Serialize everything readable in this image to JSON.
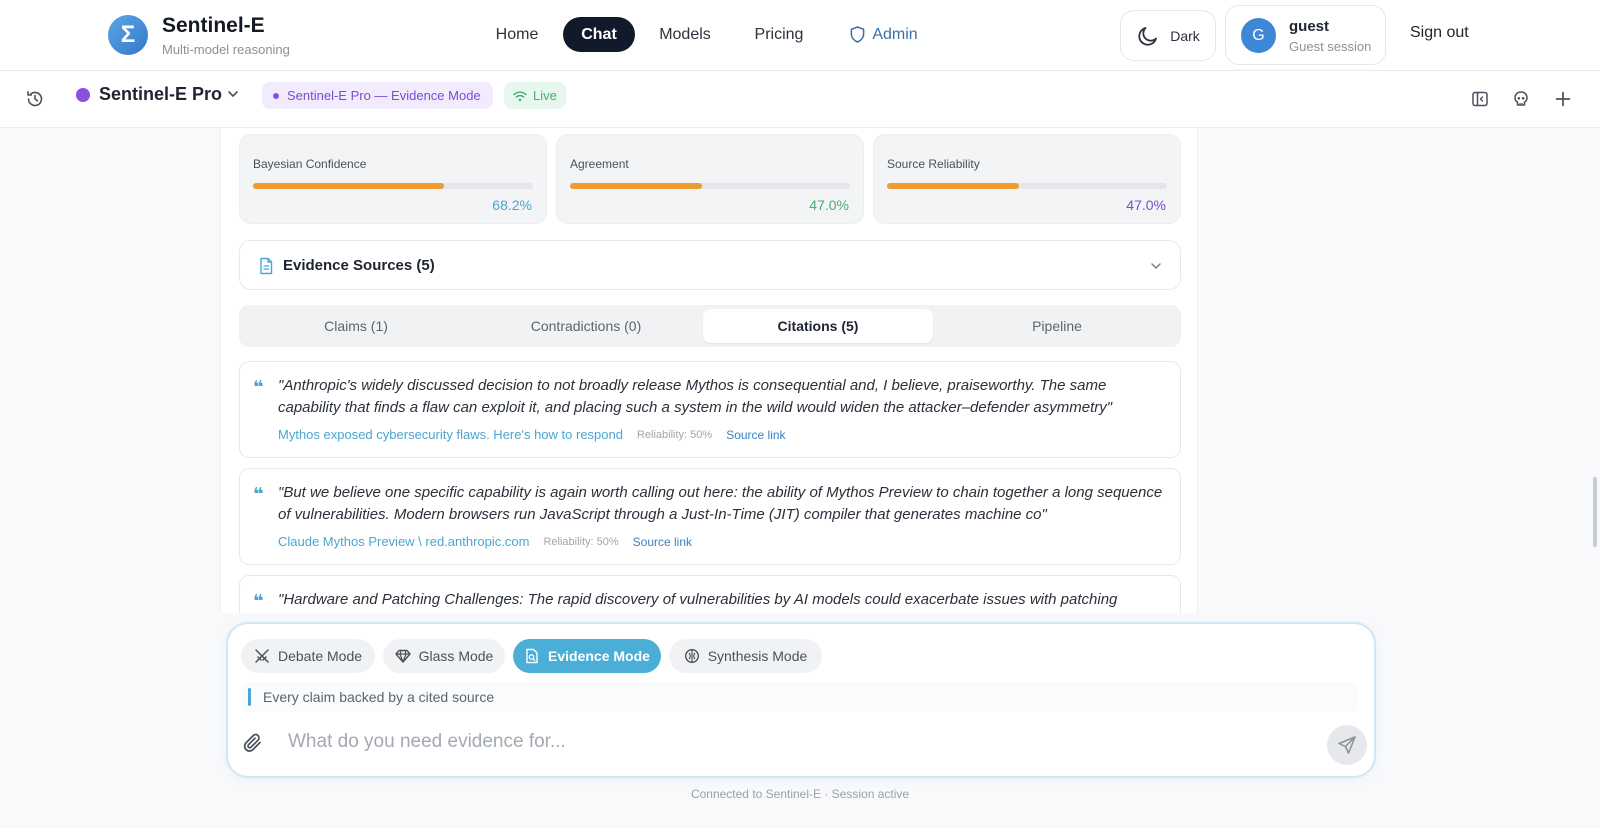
{
  "nav": {
    "brand": "Sentinel-E",
    "brand_sub": "Multi-model reasoning",
    "logo_glyph": "Σ",
    "links": {
      "home": "Home",
      "chat": "Chat",
      "models": "Models",
      "pricing": "Pricing",
      "admin": "Admin"
    },
    "theme_label": "Dark",
    "user": {
      "initial": "G",
      "name": "guest",
      "session": "Guest session"
    },
    "signout": "Sign out"
  },
  "toolbar": {
    "model_name": "Sentinel-E Pro",
    "mode_badge": "Sentinel-E Pro — Evidence Mode",
    "live_badge": "Live"
  },
  "metrics": [
    {
      "label": "Bayesian Confidence",
      "value": "68.2%",
      "fraction": 0.682,
      "value_color": "#4aa6d2"
    },
    {
      "label": "Agreement",
      "value": "47.0%",
      "fraction": 0.47,
      "value_color": "#46ad74"
    },
    {
      "label": "Source Reliability",
      "value": "47.0%",
      "fraction": 0.47,
      "value_color": "#7a4dd0"
    }
  ],
  "evidence_sources": {
    "title": "Evidence Sources (5)"
  },
  "tabs": {
    "claims": "Claims (1)",
    "contradictions": "Contradictions (0)",
    "citations": "Citations (5)",
    "pipeline": "Pipeline"
  },
  "citations": [
    {
      "text": "\"Anthropic's widely discussed decision to not broadly release Mythos is consequential and, I believe, praiseworthy. The same capability that finds a flaw can exploit it, and placing such a system in the wild would widen the attacker–defender asymmetry\"",
      "source": "Mythos exposed cybersecurity flaws. Here's how to respond",
      "reliability": "Reliability: 50%",
      "link": "Source link"
    },
    {
      "text": "\"But we believe one specific capability is again worth calling out here: the ability of Mythos Preview to chain together a long sequence of vulnerabilities. Modern browsers run JavaScript through a Just-In-Time (JIT) compiler that generates machine co\"",
      "source": "Claude Mythos Preview \\ red.anthropic.com",
      "reliability": "Reliability: 50%",
      "link": "Source link"
    },
    {
      "text": "\"Hardware and Patching Challenges: The rapid discovery of vulnerabilities by AI models could exacerbate issues with patching",
      "source": "",
      "reliability": "",
      "link": ""
    }
  ],
  "composer": {
    "modes": {
      "debate": "Debate Mode",
      "glass": "Glass Mode",
      "evidence": "Evidence Mode",
      "synthesis": "Synthesis Mode"
    },
    "hint": "Every claim backed by a cited source",
    "placeholder": "What do you need evidence for..."
  },
  "status": "Connected to Sentinel-E · Session active",
  "colors": {
    "accent": "#4aa6d2",
    "progress": "#ee9b32",
    "purple": "#8b4fe0",
    "live_green": "#46ad74"
  }
}
